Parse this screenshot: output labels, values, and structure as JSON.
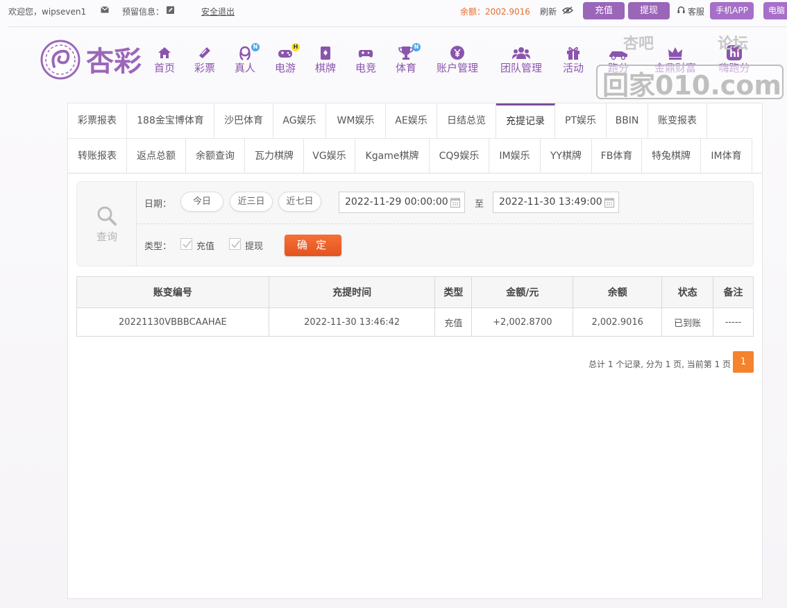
{
  "topbar": {
    "welcome": "欢迎您，wipseven1",
    "reserved_info": "预留信息：",
    "logout": "安全退出",
    "balance": "余额：2002.9016",
    "refresh": "刷新",
    "deposit": "充值",
    "withdraw": "提现",
    "service": "客服",
    "mobile_app": "手机APP",
    "pc_client": "电脑"
  },
  "logo_text": "杏彩",
  "nav": [
    {
      "label": "首页",
      "icon": "home-icon"
    },
    {
      "label": "彩票",
      "icon": "ticket-icon"
    },
    {
      "label": "真人",
      "icon": "dealer-icon",
      "badge": "N"
    },
    {
      "label": "电游",
      "icon": "gamepad-icon",
      "badge": "H"
    },
    {
      "label": "棋牌",
      "icon": "cards-icon"
    },
    {
      "label": "电竞",
      "icon": "controller-icon"
    },
    {
      "label": "体育",
      "icon": "trophy-icon",
      "badge": "N"
    },
    {
      "label": "账户管理",
      "icon": "yen-coin-icon"
    },
    {
      "label": "团队管理",
      "icon": "team-icon"
    },
    {
      "label": "活动",
      "icon": "gift-icon"
    },
    {
      "label": "跑分",
      "icon": "car-icon"
    },
    {
      "label": "金鼎财富",
      "icon": "crown-icon"
    },
    {
      "label": "嗨跑分",
      "icon": "hi-icon"
    }
  ],
  "tabs_row1": [
    "彩票报表",
    "188金宝博体育",
    "沙巴体育",
    "AG娱乐",
    "WM娱乐",
    "AE娱乐",
    "日结总览",
    "充提记录",
    "PT娱乐",
    "BBIN",
    "账变报表"
  ],
  "tabs_row2": [
    "转账报表",
    "返点总额",
    "余额查询",
    "瓦力棋牌",
    "VG娱乐",
    "Kgame棋牌",
    "CQ9娱乐",
    "IM娱乐",
    "YY棋牌",
    "FB体育",
    "特兔棋牌",
    "IM体育"
  ],
  "active_tab": "充提记录",
  "filter": {
    "query_label": "查询",
    "date_label": "日期：",
    "quick_ranges": [
      "今日",
      "近三日",
      "近七日"
    ],
    "start_date": "2022-11-29 00:00:00",
    "to": "至",
    "end_date": "2022-11-30 13:49:00",
    "type_label": "类型：",
    "type_options": [
      "充值",
      "提现"
    ],
    "confirm": "确 定"
  },
  "table": {
    "headers": [
      "账变编号",
      "充提时间",
      "类型",
      "金额/元",
      "余额",
      "状态",
      "备注"
    ],
    "rows": [
      [
        "20221130VBBBCAAHAE",
        "2022-11-30 13:46:42",
        "充值",
        "+2,002.8700",
        "2,002.9016",
        "已到账",
        "-----"
      ]
    ]
  },
  "pagination": {
    "summary": "总计 1 个记录, 分为 1 页, 当前第 1 页",
    "current_page": "1"
  },
  "watermark": {
    "line1": "杏吧",
    "line2": "论坛",
    "line3": "回家010.com"
  },
  "colors": {
    "brand_purple": "#8a55ad",
    "orange": "#f5822d",
    "amount_red": "#c62828",
    "status_green": "#3aa83a"
  }
}
